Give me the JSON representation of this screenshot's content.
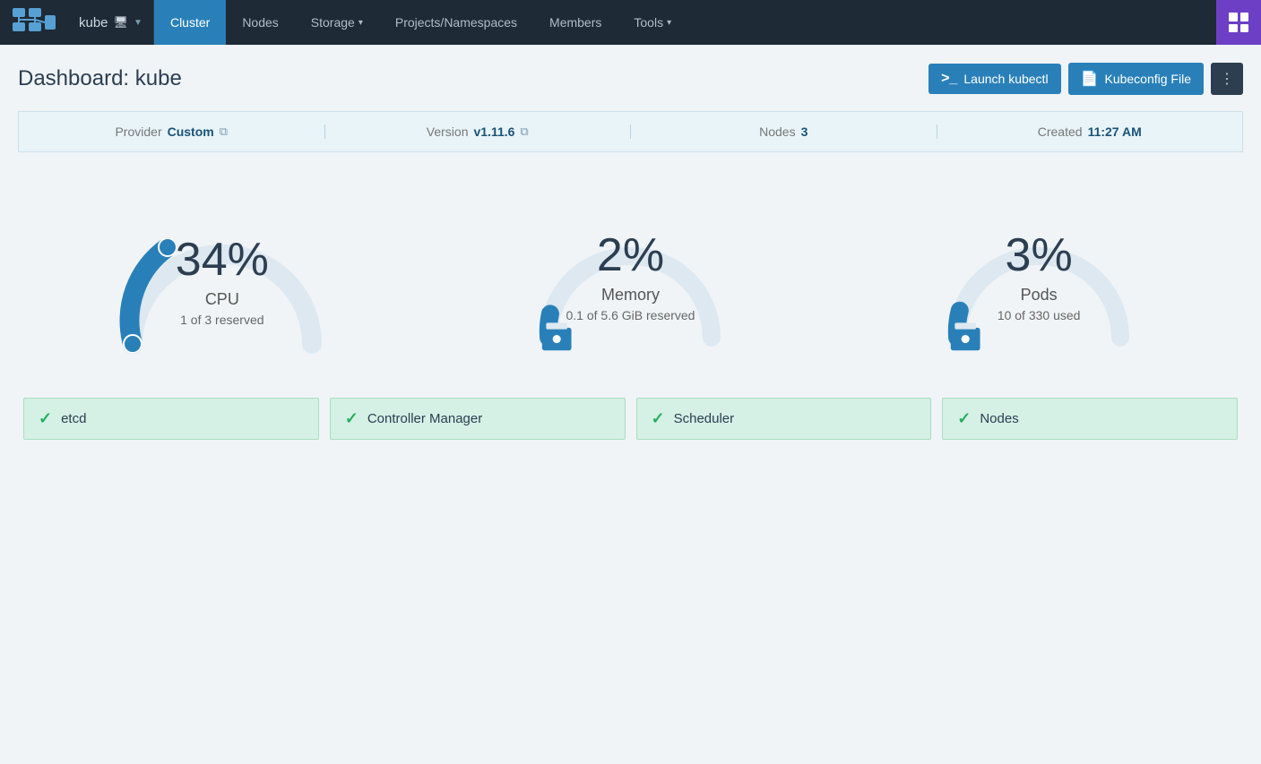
{
  "navbar": {
    "brand_alt": "Rancher",
    "kube_label": "kube",
    "nav_items": [
      {
        "label": "Cluster",
        "active": true
      },
      {
        "label": "Nodes",
        "active": false
      },
      {
        "label": "Storage",
        "active": false,
        "dropdown": true
      },
      {
        "label": "Projects/Namespaces",
        "active": false
      },
      {
        "label": "Members",
        "active": false
      },
      {
        "label": "Tools",
        "active": false,
        "dropdown": true
      }
    ]
  },
  "header": {
    "title": "Dashboard: kube",
    "launch_kubectl_label": "Launch kubectl",
    "kubeconfig_label": "Kubeconfig File",
    "more_label": "⋮"
  },
  "info_bar": {
    "provider_label": "Provider",
    "provider_value": "Custom",
    "version_label": "Version",
    "version_value": "v1.11.6",
    "nodes_label": "Nodes",
    "nodes_value": "3",
    "created_label": "Created",
    "created_value": "11:27 AM"
  },
  "gauges": [
    {
      "id": "cpu",
      "percent": 34,
      "percent_label": "34%",
      "label": "CPU",
      "sub": "1 of 3 reserved",
      "color": "#2980b9",
      "track_color": "#dde8f0"
    },
    {
      "id": "memory",
      "percent": 2,
      "percent_label": "2%",
      "label": "Memory",
      "sub": "0.1 of 5.6 GiB reserved",
      "color": "#2980b9",
      "track_color": "#dde8f0"
    },
    {
      "id": "pods",
      "percent": 3,
      "percent_label": "3%",
      "label": "Pods",
      "sub": "10 of 330 used",
      "color": "#2980b9",
      "track_color": "#dde8f0"
    }
  ],
  "status_items": [
    {
      "label": "etcd"
    },
    {
      "label": "Controller Manager"
    },
    {
      "label": "Scheduler"
    },
    {
      "label": "Nodes"
    }
  ]
}
